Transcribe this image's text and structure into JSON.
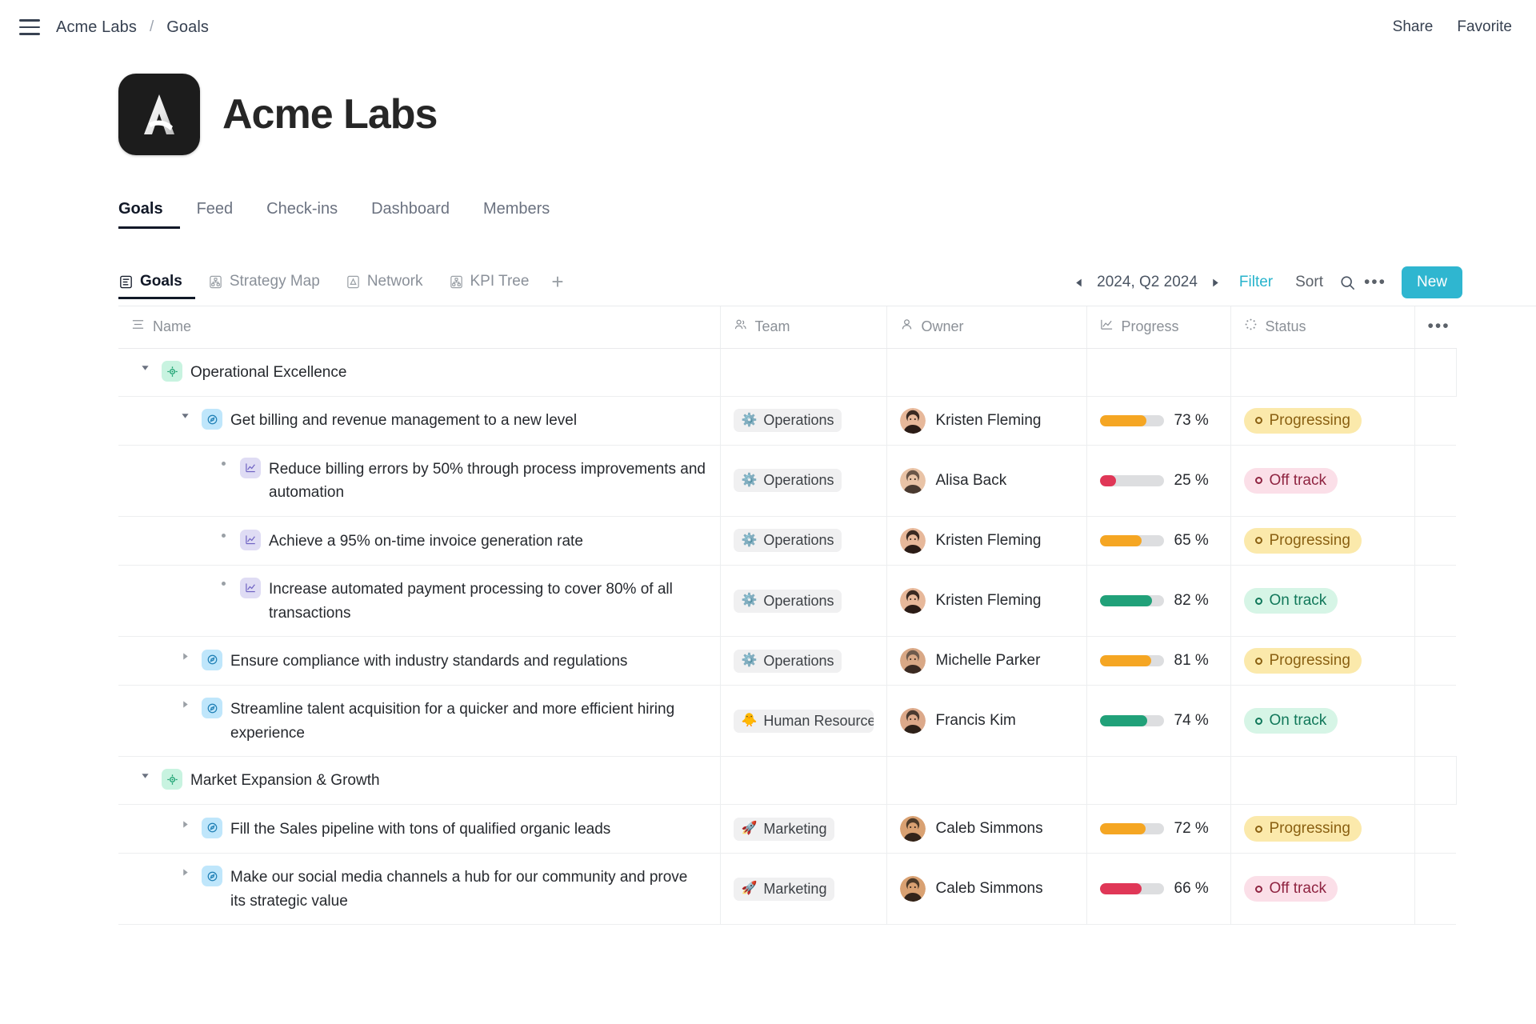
{
  "topbar": {
    "menu_icon": "hamburger-icon",
    "breadcrumb": {
      "org": "Acme Labs",
      "separator": "/",
      "page": "Goals"
    },
    "share_label": "Share",
    "favorite_label": "Favorite"
  },
  "header": {
    "org_name": "Acme Labs",
    "logo_letter": "A"
  },
  "main_nav": [
    {
      "label": "Goals",
      "active": true
    },
    {
      "label": "Feed",
      "active": false
    },
    {
      "label": "Check-ins",
      "active": false
    },
    {
      "label": "Dashboard",
      "active": false
    },
    {
      "label": "Members",
      "active": false
    }
  ],
  "view_tabs": [
    {
      "label": "Goals",
      "icon": "list-view-icon",
      "active": true
    },
    {
      "label": "Strategy Map",
      "icon": "hierarchy-icon",
      "active": false
    },
    {
      "label": "Network",
      "icon": "network-icon",
      "active": false
    },
    {
      "label": "KPI Tree",
      "icon": "tree-icon",
      "active": false
    }
  ],
  "add_view_label": "+",
  "toolbar": {
    "prev_icon": "triangle-left-icon",
    "period": "2024, Q2 2024",
    "next_icon": "triangle-right-icon",
    "filter_label": "Filter",
    "sort_label": "Sort",
    "search_icon": "search-icon",
    "more_icon": "ellipsis-icon",
    "new_label": "New"
  },
  "colors": {
    "accent": "#2fb6d0",
    "on_track": "#21a179",
    "progressing": "#f5a623",
    "off_track": "#e03757"
  },
  "table": {
    "columns": [
      {
        "label": "Name",
        "icon": "rows-icon"
      },
      {
        "label": "Team",
        "icon": "people-icon"
      },
      {
        "label": "Owner",
        "icon": "person-icon"
      },
      {
        "label": "Progress",
        "icon": "chart-icon"
      },
      {
        "label": "Status",
        "icon": "spinner-icon"
      },
      {
        "label": "",
        "icon": "ellipsis-icon"
      }
    ],
    "rows": [
      {
        "type": "group",
        "level": 1,
        "twisty": "open",
        "icon": "target-icon",
        "name": "Operational Excellence",
        "team": null,
        "owner": null,
        "progress": null,
        "status": null
      },
      {
        "type": "goal",
        "level": 2,
        "twisty": "open",
        "icon": "compass-icon",
        "name": "Get billing and revenue management to a new level",
        "team": {
          "label": "Operations",
          "emoji": "⚙️"
        },
        "owner": {
          "name": "Kristen Fleming",
          "avatar": "woman-dark-hair"
        },
        "progress": 73,
        "progress_label": "73 %",
        "status": {
          "label": "Progressing",
          "kind": "progressing"
        }
      },
      {
        "type": "kpi",
        "level": 3,
        "twisty": "bullet",
        "icon": "chart-icon",
        "name": "Reduce billing errors by 50% through process improvements and automation",
        "team": {
          "label": "Operations",
          "emoji": "⚙️"
        },
        "owner": {
          "name": "Alisa Back",
          "avatar": "woman-glasses"
        },
        "progress": 25,
        "progress_label": "25 %",
        "status": {
          "label": "Off track",
          "kind": "offtrack"
        }
      },
      {
        "type": "kpi",
        "level": 3,
        "twisty": "bullet",
        "icon": "chart-icon",
        "name": "Achieve a 95% on-time invoice generation rate",
        "team": {
          "label": "Operations",
          "emoji": "⚙️"
        },
        "owner": {
          "name": "Kristen Fleming",
          "avatar": "woman-dark-hair"
        },
        "progress": 65,
        "progress_label": "65 %",
        "status": {
          "label": "Progressing",
          "kind": "progressing"
        }
      },
      {
        "type": "kpi",
        "level": 3,
        "twisty": "bullet",
        "icon": "chart-icon",
        "name": "Increase automated payment processing to cover 80% of all transactions",
        "team": {
          "label": "Operations",
          "emoji": "⚙️"
        },
        "owner": {
          "name": "Kristen Fleming",
          "avatar": "woman-dark-hair"
        },
        "progress": 82,
        "progress_label": "82 %",
        "status": {
          "label": "On track",
          "kind": "ontrack"
        }
      },
      {
        "type": "goal",
        "level": 2,
        "twisty": "closed",
        "icon": "compass-icon",
        "name": "Ensure compliance with industry standards and regulations",
        "team": {
          "label": "Operations",
          "emoji": "⚙️"
        },
        "owner": {
          "name": "Michelle Parker",
          "avatar": "man-older"
        },
        "progress": 81,
        "progress_label": "81 %",
        "status": {
          "label": "Progressing",
          "kind": "progressing"
        }
      },
      {
        "type": "goal",
        "level": 2,
        "twisty": "closed",
        "icon": "compass-icon",
        "name": "Streamline talent acquisition for a quicker and more efficient hiring experience",
        "team": {
          "label": "Human Resources",
          "emoji": "🐥"
        },
        "owner": {
          "name": "Francis Kim",
          "avatar": "man-glasses"
        },
        "progress": 74,
        "progress_label": "74 %",
        "status": {
          "label": "On track",
          "kind": "ontrack"
        }
      },
      {
        "type": "group",
        "level": 1,
        "twisty": "open",
        "icon": "target-icon",
        "name": "Market Expansion & Growth",
        "team": null,
        "owner": null,
        "progress": null,
        "status": null
      },
      {
        "type": "goal",
        "level": 2,
        "twisty": "closed",
        "icon": "compass-icon",
        "name": "Fill the Sales pipeline with tons of qualified organic leads",
        "team": {
          "label": "Marketing",
          "emoji": "🚀"
        },
        "owner": {
          "name": "Caleb Simmons",
          "avatar": "man-beard"
        },
        "progress": 72,
        "progress_label": "72 %",
        "status": {
          "label": "Progressing",
          "kind": "progressing"
        }
      },
      {
        "type": "goal",
        "level": 2,
        "twisty": "closed",
        "icon": "compass-icon",
        "name": "Make our social media channels a hub for our community and prove its strategic value",
        "team": {
          "label": "Marketing",
          "emoji": "🚀"
        },
        "owner": {
          "name": "Caleb Simmons",
          "avatar": "man-beard"
        },
        "progress": 66,
        "progress_label": "66 %",
        "status": {
          "label": "Off track",
          "kind": "offtrack"
        }
      }
    ]
  }
}
